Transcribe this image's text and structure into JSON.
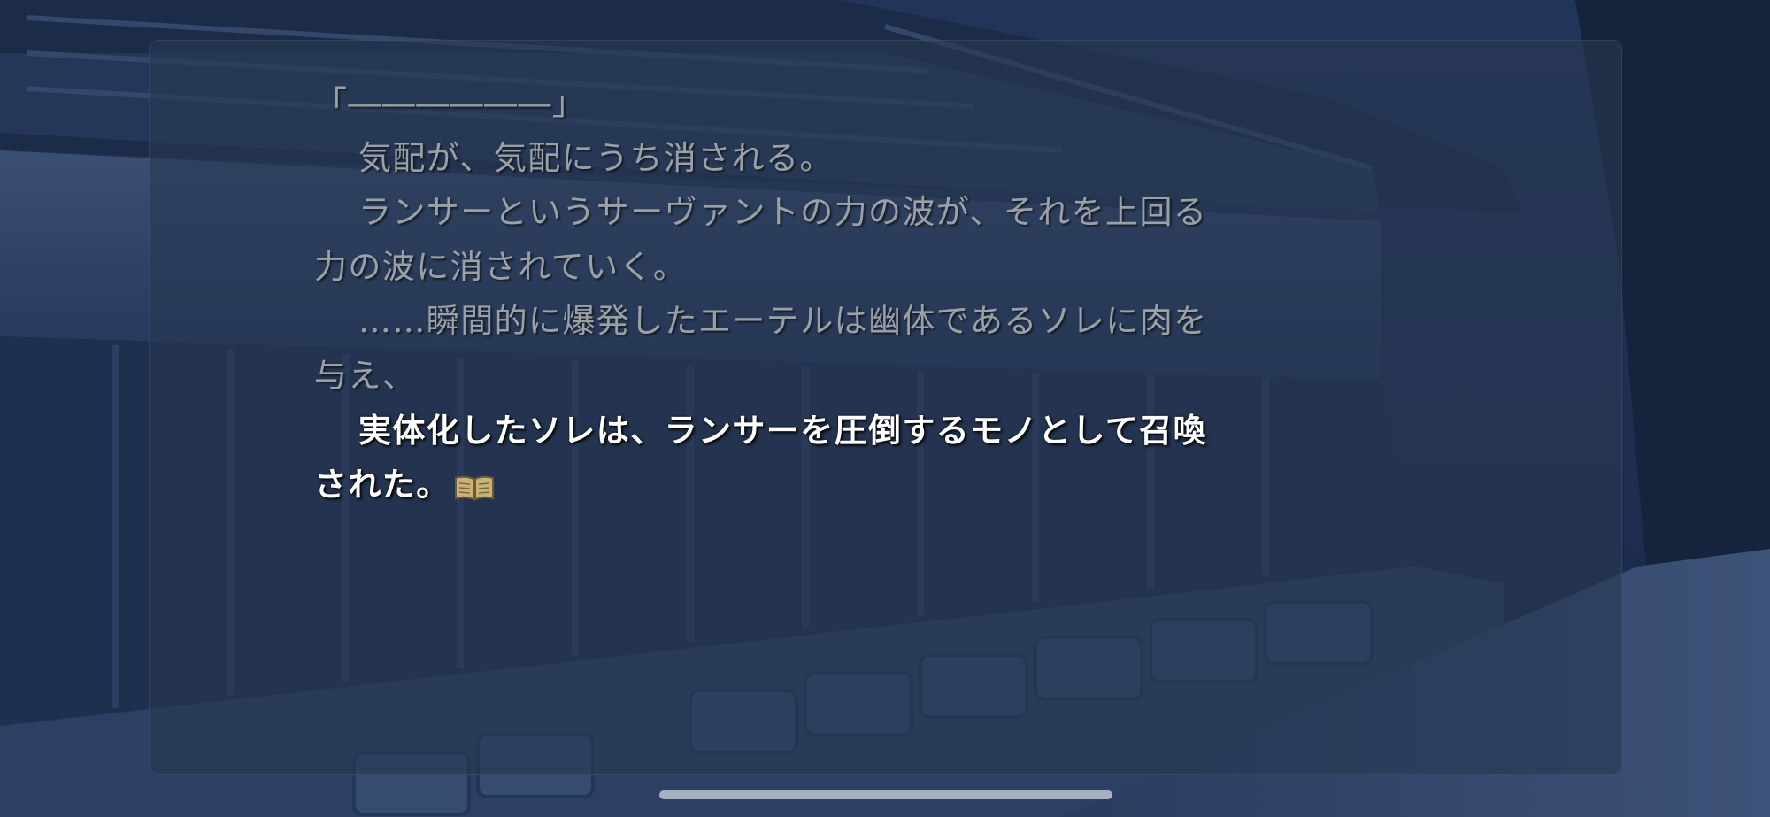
{
  "dialogue": {
    "lines": [
      {
        "text": "「――――――」",
        "state": "read",
        "indent": false
      },
      {
        "text": "気配が、気配にうち消される。",
        "state": "read",
        "indent": true
      },
      {
        "text": "ランサーというサーヴァントの力の波が、それを上回る",
        "state": "read",
        "indent": true
      },
      {
        "text": "力の波に消されていく。",
        "state": "read",
        "indent": false
      },
      {
        "text": "……瞬間的に爆発したエーテルは幽体であるソレに肉を",
        "state": "read",
        "indent": true
      },
      {
        "text": "与え、",
        "state": "read",
        "indent": false
      },
      {
        "text": "実体化したソレは、ランサーを圧倒するモノとして召喚",
        "state": "current",
        "indent": true
      },
      {
        "text": "された。",
        "state": "current",
        "indent": false
      }
    ],
    "continue_icon": "book-icon"
  },
  "colors": {
    "read_text": "#9ba0a6",
    "current_text": "#ffffff",
    "window": "#28384f",
    "background_night": "#1b2a45"
  }
}
